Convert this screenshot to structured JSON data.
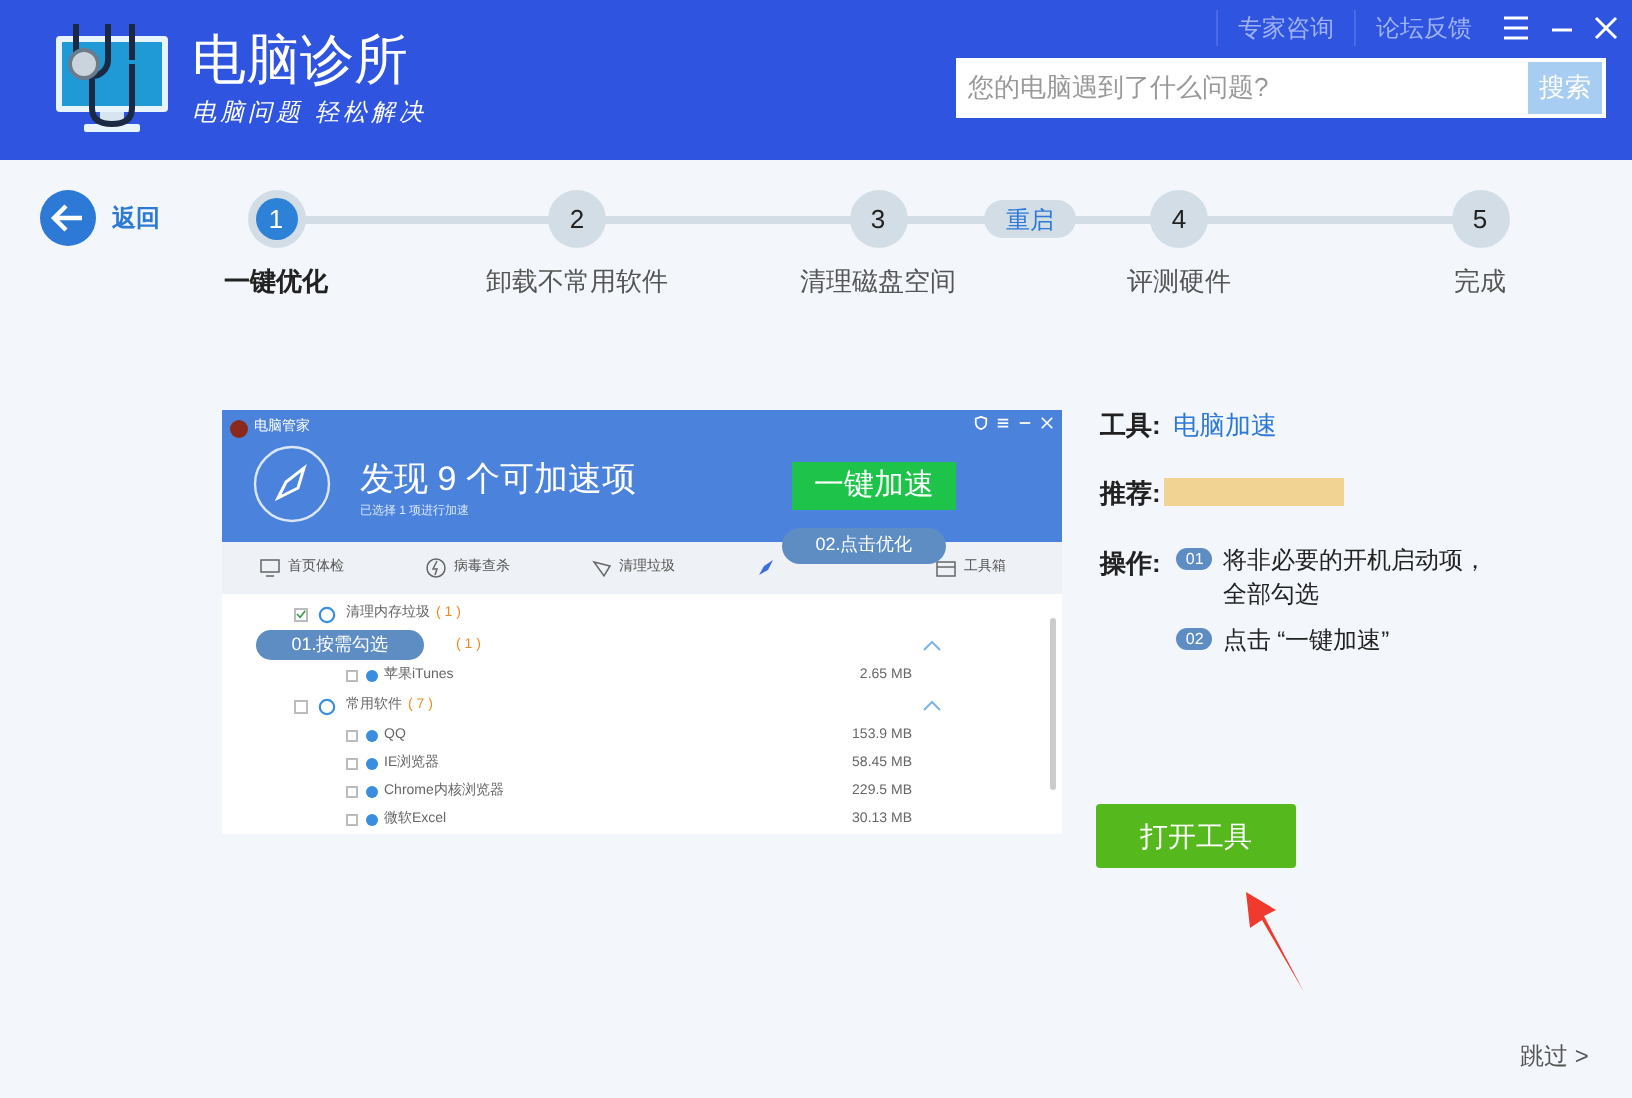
{
  "header": {
    "title": "电脑诊所",
    "slogan": "电脑问题 轻松解决",
    "top_links": [
      "专家咨询",
      "论坛反馈"
    ],
    "search": {
      "placeholder": "您的电脑遇到了什么问题?"
    },
    "search_button": "搜索"
  },
  "back": "返回",
  "steps": [
    {
      "number": "1",
      "label": "一键优化",
      "selected": true
    },
    {
      "number": "2",
      "label": "卸载不常用软件",
      "selected": false
    },
    {
      "number": "3",
      "label": "清理磁盘空间",
      "selected": false
    },
    {
      "number": "4",
      "label": "评测硬件",
      "selected": false
    },
    {
      "number": "5",
      "label": "完成",
      "selected": false
    }
  ],
  "restart_badge": "重启",
  "preview": {
    "app_title": "电脑管家",
    "headline": "发现 9 个可加速项",
    "subline": "已选择 1 项进行加速",
    "action": "一键加速",
    "tabs": [
      "首页体检",
      "病毒查杀",
      "清理垃圾",
      "工具箱"
    ],
    "callouts": [
      "01.按需勾选",
      "02.点击优化"
    ],
    "groups": [
      {
        "name": "清理内存垃圾",
        "count": "( 1 )",
        "checked": true
      },
      {
        "count": "( 1 )",
        "children": [
          {
            "name": "苹果iTunes",
            "size": "2.65 MB",
            "checked": false
          }
        ]
      },
      {
        "name": "常用软件",
        "count": "( 7 )",
        "checked": false,
        "children": [
          {
            "name": "QQ",
            "size": "153.9 MB",
            "checked": false
          },
          {
            "name": "IE浏览器",
            "size": "58.45 MB",
            "checked": false
          },
          {
            "name": "Chrome内核浏览器",
            "size": "229.5 MB",
            "checked": false
          },
          {
            "name": "微软Excel",
            "size": "30.13 MB",
            "checked": false
          }
        ]
      }
    ]
  },
  "info": {
    "tool_label": "工具:",
    "tool": "电脑加速",
    "recommend_label": "推荐:",
    "operation_label": "操作:",
    "operations": [
      {
        "badge": "01",
        "text": "将非必要的开机启动项，全部勾选"
      },
      {
        "badge": "02",
        "text": "点击 “一键加速”"
      }
    ]
  },
  "open_button": "打开工具",
  "skip": "跳过 >"
}
